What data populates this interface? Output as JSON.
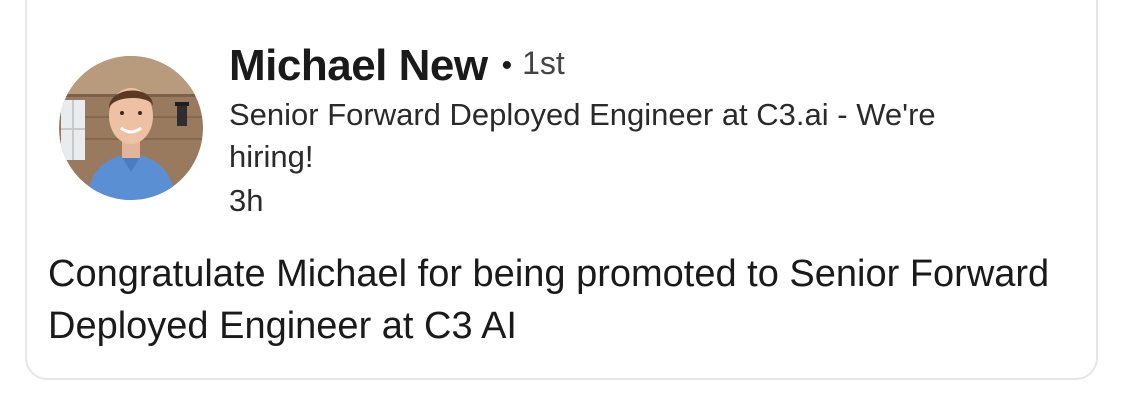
{
  "post": {
    "author": {
      "name": "Michael New",
      "separator": "•",
      "connection_degree": "1st",
      "headline": "Senior Forward Deployed Engineer at C3.ai - We're hiring!",
      "posted_ago": "3h",
      "avatar_icon": "profile-photo"
    },
    "body": "Congratulate Michael for being promoted to Senior Forward Deployed Engineer at C3 AI"
  },
  "colors": {
    "card_border": "#e6e6e6",
    "text_primary": "#1a1a1a",
    "text_secondary": "#444444"
  }
}
